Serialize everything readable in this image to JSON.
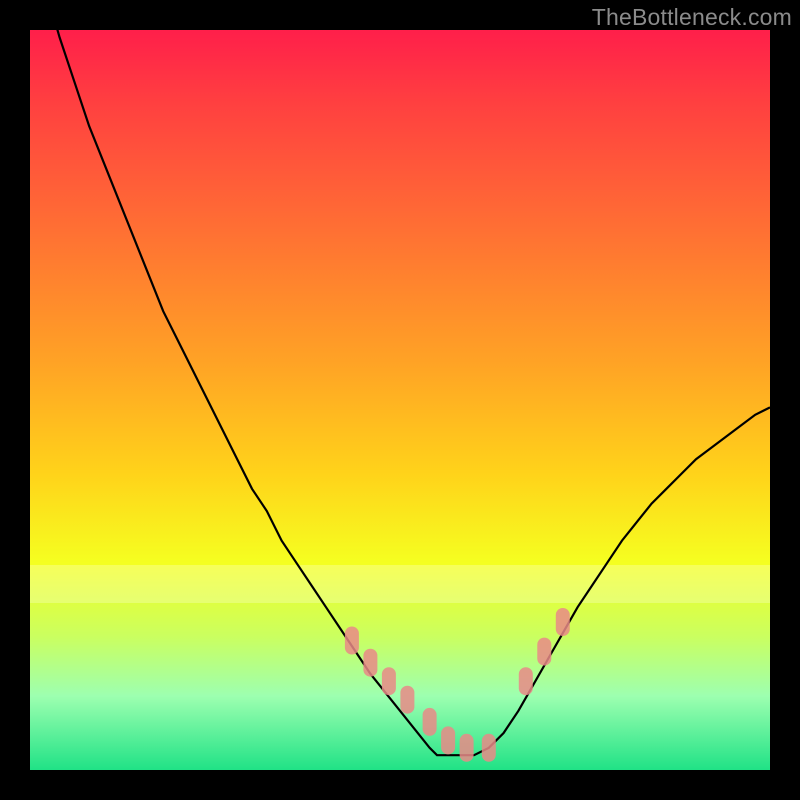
{
  "watermark": "TheBottleneck.com",
  "colors": {
    "frame": "#000000",
    "curve": "#000000",
    "markers": "#e77a7a",
    "marker_fill": "#e98987",
    "gradient_top": "#ff1f4a",
    "gradient_bottom": "#20e286"
  },
  "chart_data": {
    "type": "line",
    "title": "",
    "xlabel": "",
    "ylabel": "",
    "xlim": [
      0,
      100
    ],
    "ylim": [
      0,
      100
    ],
    "grid": false,
    "series": [
      {
        "name": "curve",
        "x": [
          0,
          2,
          4,
          6,
          8,
          10,
          12,
          14,
          16,
          18,
          20,
          22,
          24,
          26,
          28,
          30,
          32,
          34,
          36,
          38,
          40,
          42,
          44,
          46,
          48,
          50,
          52,
          54,
          55,
          56,
          58,
          60,
          62,
          64,
          66,
          68,
          70,
          72,
          74,
          76,
          78,
          80,
          82,
          84,
          86,
          88,
          90,
          92,
          94,
          96,
          98,
          100
        ],
        "y": [
          118,
          106,
          99,
          93,
          87,
          82,
          77,
          72,
          67,
          62,
          58,
          54,
          50,
          46,
          42,
          38,
          35,
          31,
          28,
          25,
          22,
          19,
          16,
          13,
          10.5,
          8,
          5.5,
          3,
          2,
          2,
          2,
          2,
          3,
          5,
          8,
          11.5,
          15,
          18.5,
          22,
          25,
          28,
          31,
          33.5,
          36,
          38,
          40,
          42,
          43.5,
          45,
          46.5,
          48,
          49
        ]
      }
    ],
    "markers": {
      "name": "highlight-points",
      "x": [
        43.5,
        46,
        48.5,
        51,
        54,
        56.5,
        59,
        62,
        67,
        69.5,
        72
      ],
      "y": [
        17.5,
        14.5,
        12,
        9.5,
        6.5,
        4,
        3,
        3,
        12,
        16,
        20
      ]
    }
  }
}
